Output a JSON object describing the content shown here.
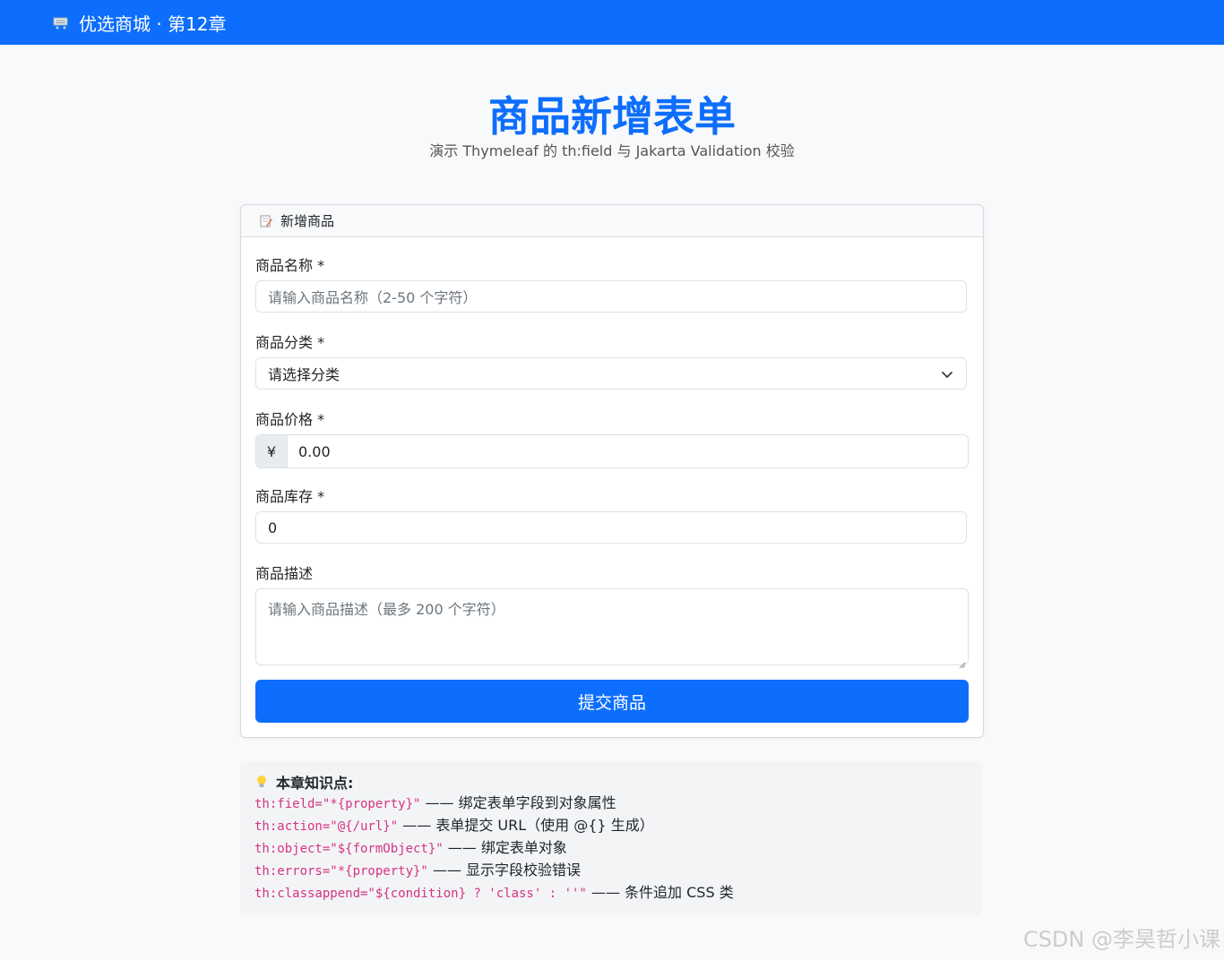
{
  "navbar": {
    "brand": "优选商城 · 第12章",
    "brand_icon": "shopping-cart-icon",
    "color": "#0d6efd"
  },
  "hero": {
    "title": "商品新增表单",
    "subtitle": "演示 Thymeleaf 的 th:field 与 Jakarta Validation 校验"
  },
  "form": {
    "header": "新增商品",
    "header_icon": "memo-icon",
    "name": {
      "label": "商品名称 *",
      "placeholder": "请输入商品名称（2-50 个字符）"
    },
    "category": {
      "label": "商品分类 *",
      "selected": "请选择分类"
    },
    "price": {
      "label": "商品价格 *",
      "prefix": "¥",
      "value": "0.00"
    },
    "stock": {
      "label": "商品库存 *",
      "value": "0"
    },
    "description": {
      "label": "商品描述",
      "placeholder": "请输入商品描述（最多 200 个字符）"
    },
    "submit_label": "提交商品"
  },
  "notes": {
    "title": "本章知识点:",
    "icon": "lightbulb-icon",
    "items": [
      {
        "code": "th:field=\"*{property}\"",
        "text": " —— 绑定表单字段到对象属性"
      },
      {
        "code": "th:action=\"@{/url}\"",
        "text": " —— 表单提交 URL（使用 @{} 生成）"
      },
      {
        "code": "th:object=\"${formObject}\"",
        "text": " —— 绑定表单对象"
      },
      {
        "code": "th:errors=\"*{property}\"",
        "text": " —— 显示字段校验错误"
      },
      {
        "code": "th:classappend=\"${condition} ? 'class' : ''\"",
        "text": " —— 条件追加 CSS 类"
      }
    ]
  },
  "watermark": "CSDN @李昊哲小课"
}
